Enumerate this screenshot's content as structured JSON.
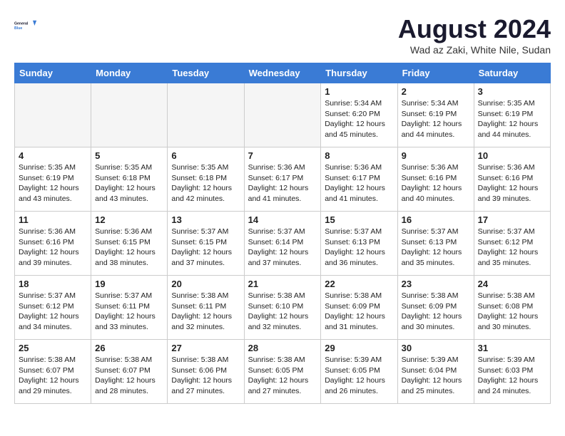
{
  "header": {
    "logo_line1": "General",
    "logo_line2": "Blue",
    "month_year": "August 2024",
    "location": "Wad az Zaki, White Nile, Sudan"
  },
  "weekdays": [
    "Sunday",
    "Monday",
    "Tuesday",
    "Wednesday",
    "Thursday",
    "Friday",
    "Saturday"
  ],
  "weeks": [
    [
      {
        "day": "",
        "detail": ""
      },
      {
        "day": "",
        "detail": ""
      },
      {
        "day": "",
        "detail": ""
      },
      {
        "day": "",
        "detail": ""
      },
      {
        "day": "1",
        "detail": "Sunrise: 5:34 AM\nSunset: 6:20 PM\nDaylight: 12 hours\nand 45 minutes."
      },
      {
        "day": "2",
        "detail": "Sunrise: 5:34 AM\nSunset: 6:19 PM\nDaylight: 12 hours\nand 44 minutes."
      },
      {
        "day": "3",
        "detail": "Sunrise: 5:35 AM\nSunset: 6:19 PM\nDaylight: 12 hours\nand 44 minutes."
      }
    ],
    [
      {
        "day": "4",
        "detail": "Sunrise: 5:35 AM\nSunset: 6:19 PM\nDaylight: 12 hours\nand 43 minutes."
      },
      {
        "day": "5",
        "detail": "Sunrise: 5:35 AM\nSunset: 6:18 PM\nDaylight: 12 hours\nand 43 minutes."
      },
      {
        "day": "6",
        "detail": "Sunrise: 5:35 AM\nSunset: 6:18 PM\nDaylight: 12 hours\nand 42 minutes."
      },
      {
        "day": "7",
        "detail": "Sunrise: 5:36 AM\nSunset: 6:17 PM\nDaylight: 12 hours\nand 41 minutes."
      },
      {
        "day": "8",
        "detail": "Sunrise: 5:36 AM\nSunset: 6:17 PM\nDaylight: 12 hours\nand 41 minutes."
      },
      {
        "day": "9",
        "detail": "Sunrise: 5:36 AM\nSunset: 6:16 PM\nDaylight: 12 hours\nand 40 minutes."
      },
      {
        "day": "10",
        "detail": "Sunrise: 5:36 AM\nSunset: 6:16 PM\nDaylight: 12 hours\nand 39 minutes."
      }
    ],
    [
      {
        "day": "11",
        "detail": "Sunrise: 5:36 AM\nSunset: 6:16 PM\nDaylight: 12 hours\nand 39 minutes."
      },
      {
        "day": "12",
        "detail": "Sunrise: 5:36 AM\nSunset: 6:15 PM\nDaylight: 12 hours\nand 38 minutes."
      },
      {
        "day": "13",
        "detail": "Sunrise: 5:37 AM\nSunset: 6:15 PM\nDaylight: 12 hours\nand 37 minutes."
      },
      {
        "day": "14",
        "detail": "Sunrise: 5:37 AM\nSunset: 6:14 PM\nDaylight: 12 hours\nand 37 minutes."
      },
      {
        "day": "15",
        "detail": "Sunrise: 5:37 AM\nSunset: 6:13 PM\nDaylight: 12 hours\nand 36 minutes."
      },
      {
        "day": "16",
        "detail": "Sunrise: 5:37 AM\nSunset: 6:13 PM\nDaylight: 12 hours\nand 35 minutes."
      },
      {
        "day": "17",
        "detail": "Sunrise: 5:37 AM\nSunset: 6:12 PM\nDaylight: 12 hours\nand 35 minutes."
      }
    ],
    [
      {
        "day": "18",
        "detail": "Sunrise: 5:37 AM\nSunset: 6:12 PM\nDaylight: 12 hours\nand 34 minutes."
      },
      {
        "day": "19",
        "detail": "Sunrise: 5:37 AM\nSunset: 6:11 PM\nDaylight: 12 hours\nand 33 minutes."
      },
      {
        "day": "20",
        "detail": "Sunrise: 5:38 AM\nSunset: 6:11 PM\nDaylight: 12 hours\nand 32 minutes."
      },
      {
        "day": "21",
        "detail": "Sunrise: 5:38 AM\nSunset: 6:10 PM\nDaylight: 12 hours\nand 32 minutes."
      },
      {
        "day": "22",
        "detail": "Sunrise: 5:38 AM\nSunset: 6:09 PM\nDaylight: 12 hours\nand 31 minutes."
      },
      {
        "day": "23",
        "detail": "Sunrise: 5:38 AM\nSunset: 6:09 PM\nDaylight: 12 hours\nand 30 minutes."
      },
      {
        "day": "24",
        "detail": "Sunrise: 5:38 AM\nSunset: 6:08 PM\nDaylight: 12 hours\nand 30 minutes."
      }
    ],
    [
      {
        "day": "25",
        "detail": "Sunrise: 5:38 AM\nSunset: 6:07 PM\nDaylight: 12 hours\nand 29 minutes."
      },
      {
        "day": "26",
        "detail": "Sunrise: 5:38 AM\nSunset: 6:07 PM\nDaylight: 12 hours\nand 28 minutes."
      },
      {
        "day": "27",
        "detail": "Sunrise: 5:38 AM\nSunset: 6:06 PM\nDaylight: 12 hours\nand 27 minutes."
      },
      {
        "day": "28",
        "detail": "Sunrise: 5:38 AM\nSunset: 6:05 PM\nDaylight: 12 hours\nand 27 minutes."
      },
      {
        "day": "29",
        "detail": "Sunrise: 5:39 AM\nSunset: 6:05 PM\nDaylight: 12 hours\nand 26 minutes."
      },
      {
        "day": "30",
        "detail": "Sunrise: 5:39 AM\nSunset: 6:04 PM\nDaylight: 12 hours\nand 25 minutes."
      },
      {
        "day": "31",
        "detail": "Sunrise: 5:39 AM\nSunset: 6:03 PM\nDaylight: 12 hours\nand 24 minutes."
      }
    ]
  ]
}
